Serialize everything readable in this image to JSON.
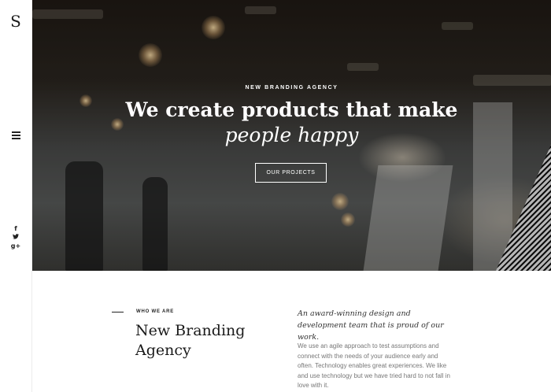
{
  "sidebar": {
    "logo": "S",
    "socials": [
      {
        "icon": "facebook-icon",
        "glyph": "f"
      },
      {
        "icon": "twitter-icon",
        "glyph": "🐦"
      },
      {
        "icon": "google-plus-icon",
        "glyph": "g+"
      }
    ]
  },
  "hero": {
    "eyebrow": "NEW BRANDING AGENCY",
    "headline": "We create products that make",
    "headline_italic": "people happy",
    "cta_label": "OUR PROJECTS"
  },
  "about": {
    "label": "WHO WE ARE",
    "title": "New Branding Agency",
    "tagline": "An award-winning design and development team that is proud of our work.",
    "body": "We use an agile approach to test assumptions and connect with the needs of your audience early and often. Technology enables great experiences. We like and use technology but we have tried hard to not fall in love with it."
  },
  "colors": {
    "text": "#222222",
    "muted": "#777777",
    "background": "#ffffff"
  }
}
